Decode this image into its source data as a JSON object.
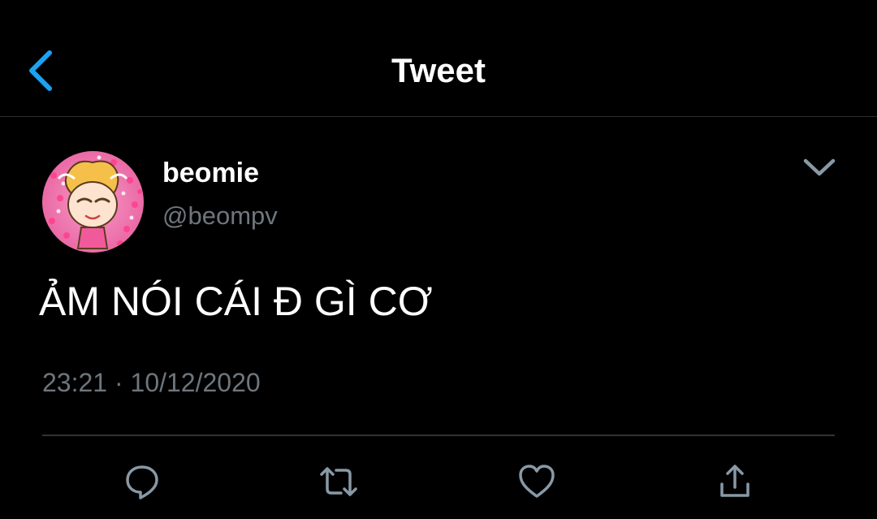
{
  "header": {
    "title": "Tweet"
  },
  "tweet": {
    "display_name": "beomie",
    "handle": "@beompv",
    "text": "ẢM NÓI CÁI Đ GÌ CƠ",
    "timestamp": "23:21 · 10/12/2020"
  },
  "icons": {
    "back": "chevron-left-icon",
    "more": "chevron-down-icon",
    "reply": "comment-icon",
    "retweet": "retweet-icon",
    "like": "heart-icon",
    "share": "share-icon"
  },
  "colors": {
    "background": "#000000",
    "accent": "#1da1f2",
    "secondary_text": "#6e767d",
    "divider": "#2f3336",
    "avatar_background": "#f07ab0"
  }
}
